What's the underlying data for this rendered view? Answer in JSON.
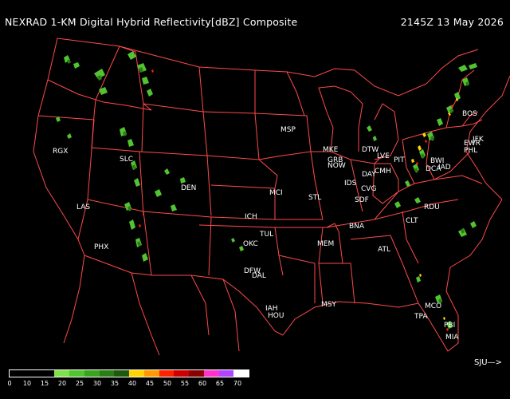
{
  "title": "NEXRAD 1-KM Digital Hybrid Reflectivity[dBZ] Composite",
  "timestamp": "2145Z 13 May 2026",
  "scroll_label": "SJU—>",
  "colors": {
    "border": "#ff4a4a",
    "background": "#000000",
    "label": "#ffffff",
    "legend": [
      "#000000",
      "#000000",
      "#000000",
      "#7fe24a",
      "#52c431",
      "#3aa31f",
      "#2b7d15",
      "#1e5a0d",
      "#ffd400",
      "#ff9a00",
      "#ff2200",
      "#cc0000",
      "#8a0000",
      "#ff33cc",
      "#b045ff",
      "#ffffff"
    ]
  },
  "legend_ticks": [
    "0",
    "10",
    "15",
    "20",
    "25",
    "30",
    "35",
    "40",
    "45",
    "50",
    "55",
    "60",
    "65",
    "70"
  ],
  "stations": [
    "RGX",
    "SLC",
    "LAS",
    "PHX",
    "DEN",
    "MSP",
    "MKE",
    "GRB",
    "NOW",
    "DTW",
    "LVE",
    "PIT",
    "BOS",
    "EWR",
    "JFK",
    "PHL",
    "BWI",
    "DCA",
    "IAD",
    "DAY",
    "CMH",
    "CVG",
    "SDF",
    "IDS",
    "STL",
    "MCI",
    "ICH",
    "TUL",
    "OKC",
    "DFW",
    "DAL",
    "IAH",
    "HOU",
    "MSY",
    "MEM",
    "BNA",
    "ATL",
    "CLT",
    "RDU",
    "MCO",
    "TPA",
    "PBI",
    "MIA"
  ]
}
